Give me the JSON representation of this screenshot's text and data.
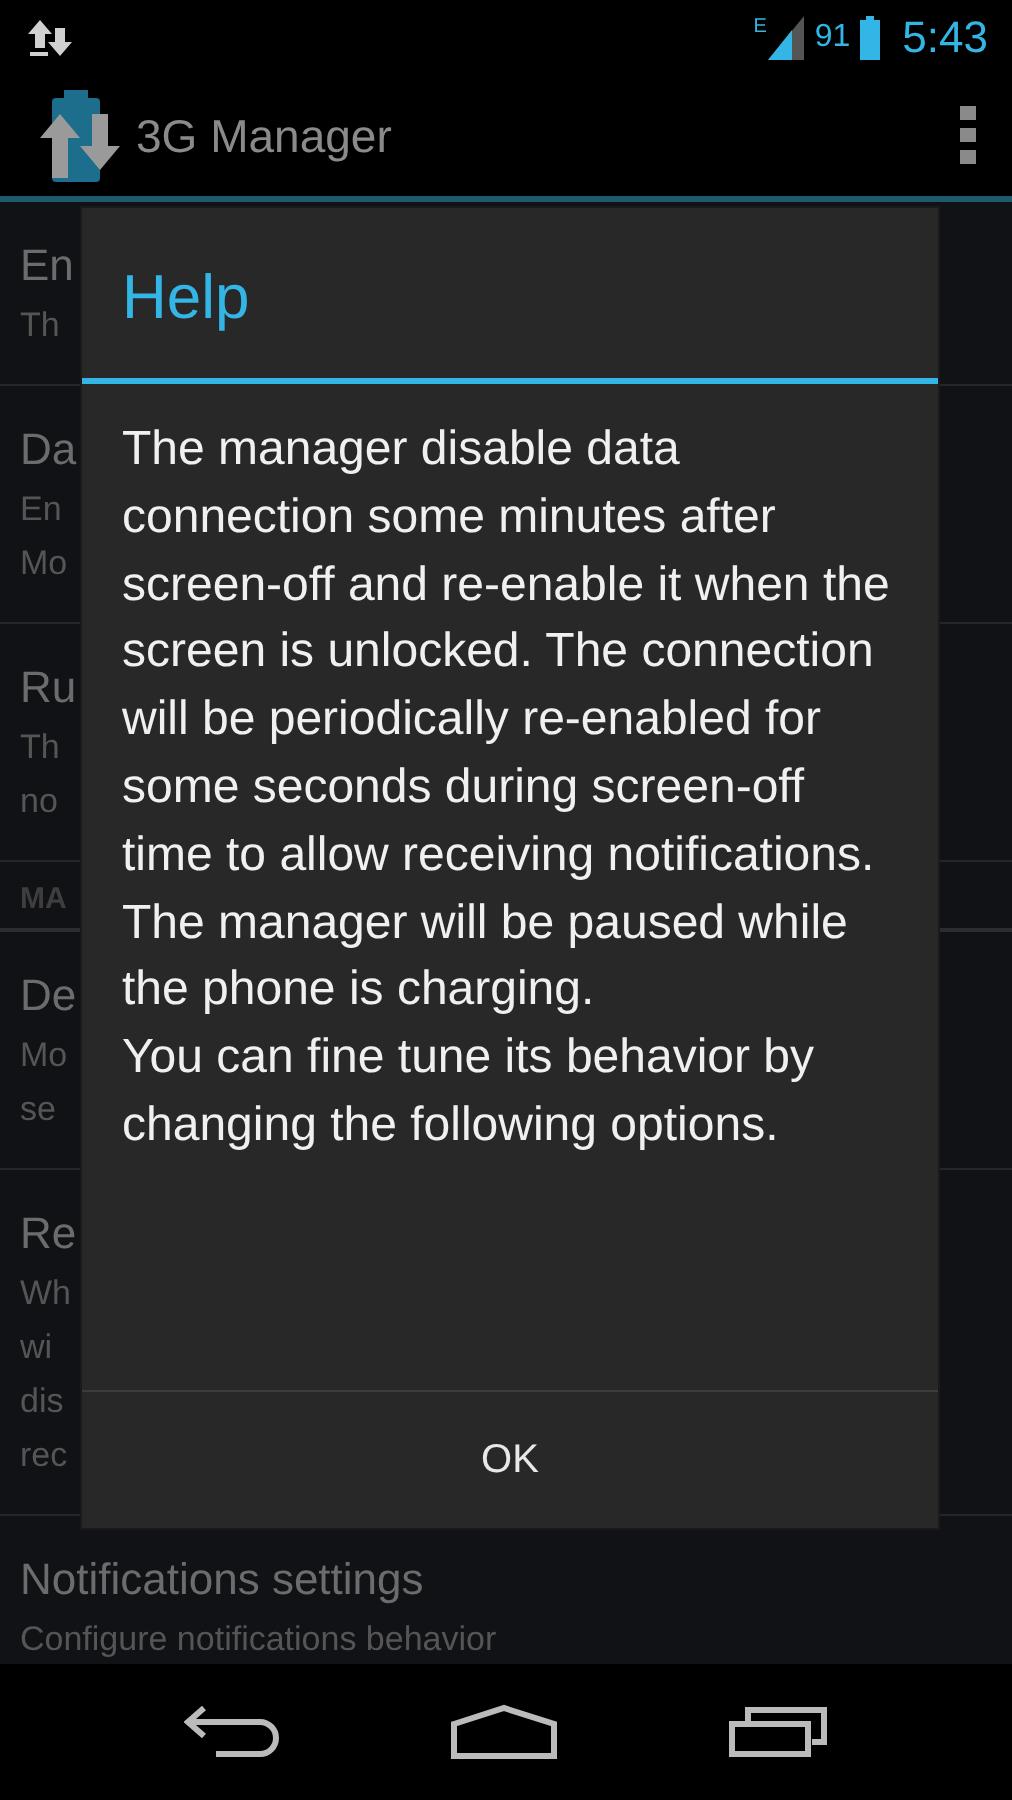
{
  "status_bar": {
    "network_type": "E",
    "battery_percent": "91",
    "time": "5:43"
  },
  "action_bar": {
    "title": "3G Manager"
  },
  "preferences": [
    {
      "kind": "item",
      "title": "En",
      "summary": [
        "Th"
      ]
    },
    {
      "kind": "item",
      "title": "Da",
      "summary": [
        "En",
        "Mo"
      ]
    },
    {
      "kind": "item",
      "title": "Ru",
      "summary": [
        "Th",
        "no"
      ]
    },
    {
      "kind": "category",
      "title": "MA"
    },
    {
      "kind": "item",
      "title": "De",
      "summary": [
        "Mo",
        "se"
      ]
    },
    {
      "kind": "item",
      "title": "Re",
      "summary": [
        "Wh",
        "wi",
        "dis",
        "rec"
      ]
    },
    {
      "kind": "item",
      "title": "Notifications settings",
      "summary": [
        "Configure notifications behavior"
      ]
    }
  ],
  "dialog": {
    "title": "Help",
    "paragraphs": [
      "The manager disable data connection some minutes after screen-off and re-enable it when the screen is unlocked. The connection will be periodically re-enabled for some seconds during screen-off time to allow receiving notifications. The manager will be paused while the phone is charging.",
      "You can fine tune its behavior by changing the following options."
    ],
    "buttons": [
      "OK"
    ]
  }
}
